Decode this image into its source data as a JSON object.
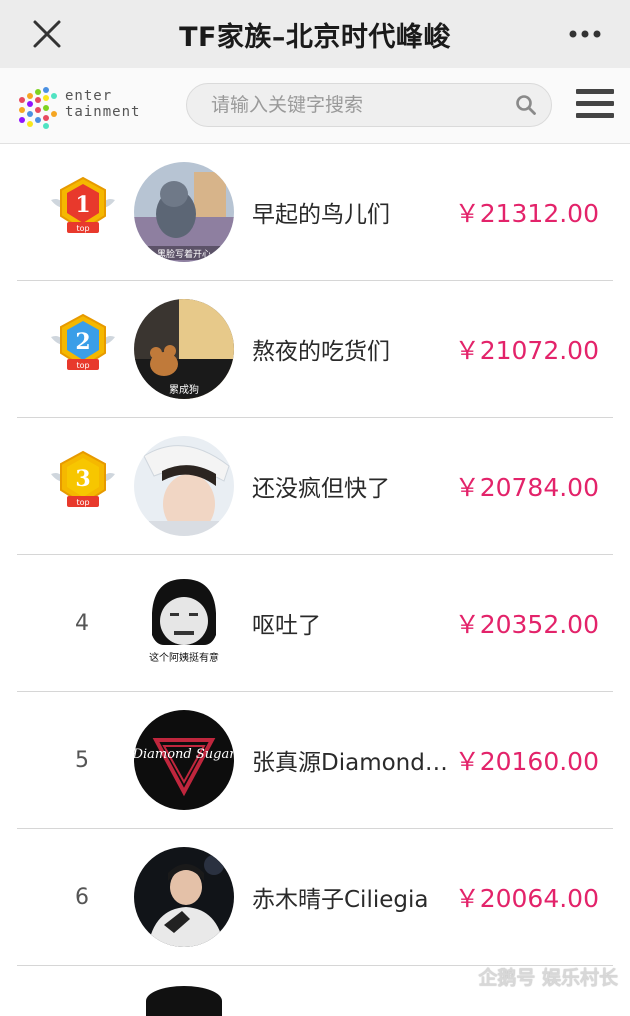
{
  "window": {
    "title": "TF家族–北京时代峰峻",
    "close_icon": "close-icon",
    "more_icon": "more-dots-icon"
  },
  "header": {
    "logo_line1": "enter",
    "logo_line2": "tainment",
    "search_placeholder": "请输入关键字搜索",
    "search_icon": "search-icon",
    "menu_icon": "hamburger-menu-icon"
  },
  "ranking": [
    {
      "rank": "1",
      "badge_label": "top",
      "name": "早起的鸟儿们",
      "amount": "￥21312.00",
      "avatar_caption": "黑脸写着开心"
    },
    {
      "rank": "2",
      "badge_label": "top",
      "name": "熬夜的吃货们",
      "amount": "￥21072.00",
      "avatar_caption": "累成狗"
    },
    {
      "rank": "3",
      "badge_label": "top",
      "name": "还没疯但快了",
      "amount": "￥20784.00",
      "avatar_caption": ""
    },
    {
      "rank": "4",
      "badge_label": "",
      "name": "呕吐了",
      "amount": "￥20352.00",
      "avatar_caption": "这个阿姨挺有意"
    },
    {
      "rank": "5",
      "badge_label": "",
      "name": "张真源DiamondS…",
      "amount": "￥20160.00",
      "avatar_caption": "Diamond Sugar"
    },
    {
      "rank": "6",
      "badge_label": "",
      "name": "赤木晴子Ciliegia",
      "amount": "￥20064.00",
      "avatar_caption": ""
    }
  ],
  "watermark": "企鹅号 娱乐村长",
  "colors": {
    "amount": "#e3236a",
    "badge_gold": "#f5b800",
    "badge_red": "#e8392c",
    "badge_blue": "#3a9ee8"
  }
}
